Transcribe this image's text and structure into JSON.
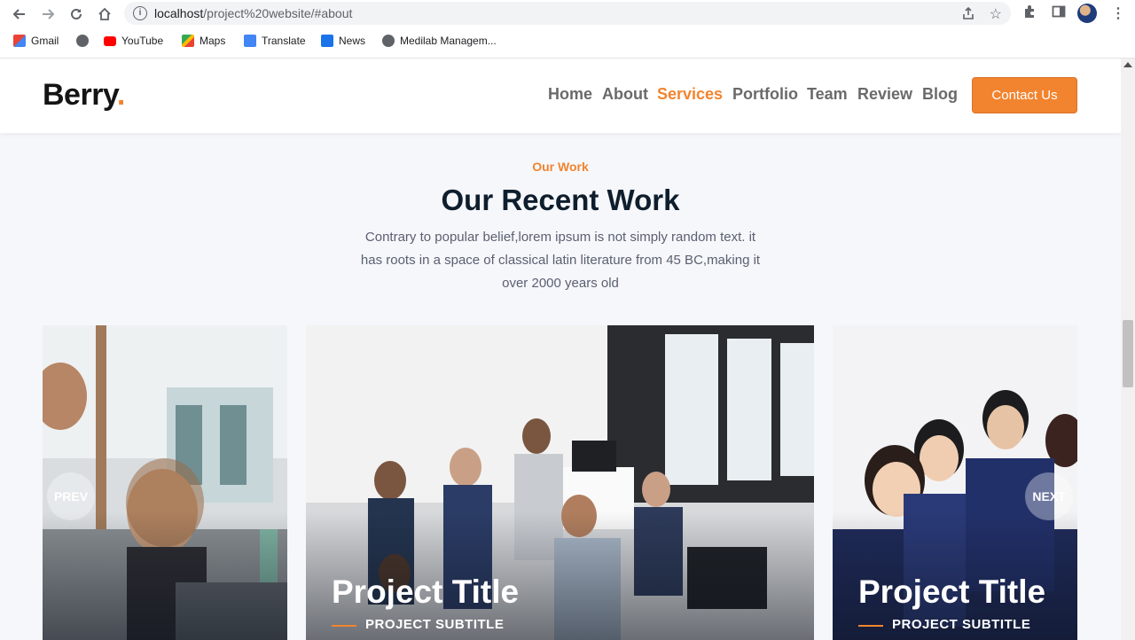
{
  "browser": {
    "url_host": "localhost",
    "url_path": "/project%20website/#about",
    "bookmarks": [
      "Gmail",
      "YouTube",
      "Maps",
      "Translate",
      "News",
      "Medilab Managem..."
    ]
  },
  "site": {
    "logo": "Berry",
    "logo_dot": ".",
    "nav": [
      "Home",
      "About",
      "Services",
      "Portfolio",
      "Team",
      "Review",
      "Blog"
    ],
    "active_nav": "Services",
    "contact_label": "Contact Us",
    "accent_color": "#f2842f"
  },
  "section": {
    "eyebrow": "Our Work",
    "title": "Our Recent Work",
    "description": "Contrary to popular belief,lorem ipsum is not simply random text. it has roots in a space of classical latin literature from 45 BC,making it over 2000 years old"
  },
  "carousel": {
    "prev_label": "PREV",
    "next_label": "NEXT",
    "cards": [
      {
        "title": "",
        "subtitle": ""
      },
      {
        "title": "Project Title",
        "subtitle": "PROJECT SUBTITLE"
      },
      {
        "title": "Project Title",
        "subtitle": "PROJECT SUBTITLE"
      }
    ]
  }
}
